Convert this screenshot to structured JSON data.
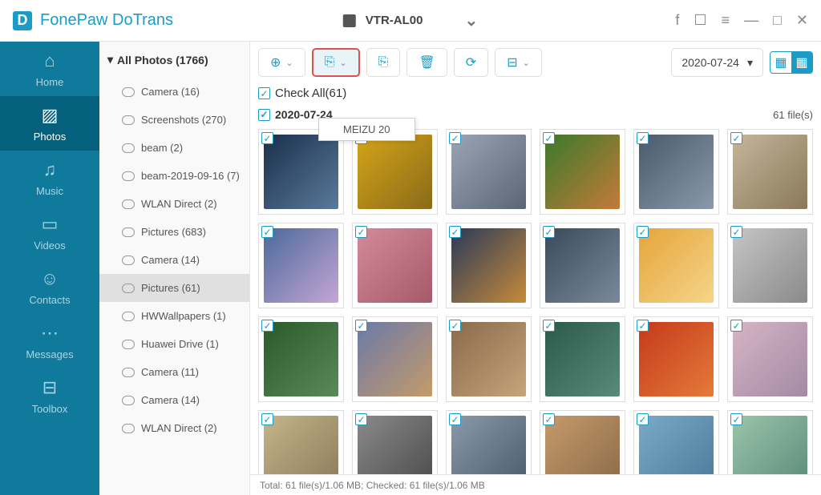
{
  "app": {
    "name": "FonePaw DoTrans"
  },
  "device": {
    "name": "VTR-AL00"
  },
  "sidebar": [
    {
      "id": "home",
      "label": "Home",
      "icon": "⌂"
    },
    {
      "id": "photos",
      "label": "Photos",
      "icon": "▨",
      "active": true
    },
    {
      "id": "music",
      "label": "Music",
      "icon": "♫"
    },
    {
      "id": "videos",
      "label": "Videos",
      "icon": "▭"
    },
    {
      "id": "contacts",
      "label": "Contacts",
      "icon": "☺"
    },
    {
      "id": "messages",
      "label": "Messages",
      "icon": "⋯"
    },
    {
      "id": "toolbox",
      "label": "Toolbox",
      "icon": "⊟"
    }
  ],
  "folders": {
    "header": "All Photos (1766)",
    "items": [
      {
        "label": "Camera (16)"
      },
      {
        "label": "Screenshots (270)"
      },
      {
        "label": "beam (2)"
      },
      {
        "label": "beam-2019-09-16 (7)"
      },
      {
        "label": "WLAN Direct (2)"
      },
      {
        "label": "Pictures (683)"
      },
      {
        "label": "Camera (14)"
      },
      {
        "label": "Pictures (61)",
        "selected": true
      },
      {
        "label": "HWWallpapers (1)"
      },
      {
        "label": "Huawei Drive (1)"
      },
      {
        "label": "Camera (11)"
      },
      {
        "label": "Camera (14)"
      },
      {
        "label": "WLAN Direct (2)"
      }
    ]
  },
  "tooltip": "MEIZU 20",
  "checkAll": {
    "label": "Check All(61)"
  },
  "dateGroup": {
    "date": "2020-07-24",
    "count": "61 file(s)"
  },
  "dateSelector": "2020-07-24",
  "status": "Total: 61 file(s)/1.06 MB; Checked: 61 file(s)/1.06 MB",
  "thumbs": [
    {
      "c1": "#1a2f4a",
      "c2": "#5a7a9a"
    },
    {
      "c1": "#d4a517",
      "c2": "#8a6a1a"
    },
    {
      "c1": "#9aa5b5",
      "c2": "#5a6575"
    },
    {
      "c1": "#3a7a2a",
      "c2": "#c57a3a"
    },
    {
      "c1": "#4a5a6a",
      "c2": "#8a9aaa"
    },
    {
      "c1": "#c5b59a",
      "c2": "#8a7a5a"
    },
    {
      "c1": "#4a6a9a",
      "c2": "#c5a5d5"
    },
    {
      "c1": "#d58a9a",
      "c2": "#a55a6a"
    },
    {
      "c1": "#2a3a5a",
      "c2": "#c58a3a"
    },
    {
      "c1": "#3a4a5a",
      "c2": "#7a8a9a"
    },
    {
      "c1": "#e5a53a",
      "c2": "#f5d58a"
    },
    {
      "c1": "#c5c5c5",
      "c2": "#8a8a8a"
    },
    {
      "c1": "#2a5a2a",
      "c2": "#5a8a5a"
    },
    {
      "c1": "#6a7aaa",
      "c2": "#c59a6a"
    },
    {
      "c1": "#8a6a4a",
      "c2": "#c5a57a"
    },
    {
      "c1": "#2a5a4a",
      "c2": "#5a8a7a"
    },
    {
      "c1": "#c53a1a",
      "c2": "#e57a3a"
    },
    {
      "c1": "#d5b5c5",
      "c2": "#a58aa5"
    },
    {
      "c1": "#c5b58a",
      "c2": "#8a7a5a"
    },
    {
      "c1": "#8a8a8a",
      "c2": "#4a4a4a"
    },
    {
      "c1": "#8a9aaa",
      "c2": "#4a5a6a"
    },
    {
      "c1": "#c59a6a",
      "c2": "#8a6a4a"
    },
    {
      "c1": "#7aaac5",
      "c2": "#4a7a9a"
    },
    {
      "c1": "#9ac5aa",
      "c2": "#5a8a7a"
    }
  ]
}
